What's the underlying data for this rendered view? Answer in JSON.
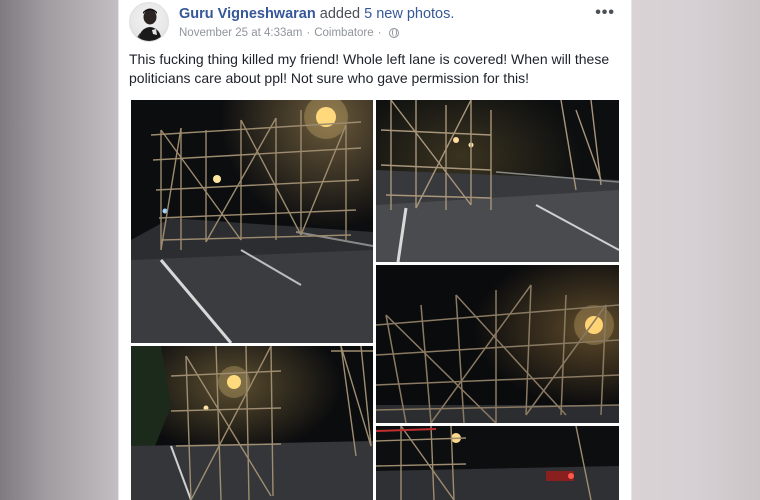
{
  "post": {
    "author": "Guru Vigneshwaran",
    "action": "added",
    "photo_count_text": "5 new photos.",
    "timestamp": "November 25 at 4:33am",
    "location": "Coimbatore",
    "separator": "·",
    "privacy_icon": "globe-icon",
    "more_icon": "•••",
    "text": "This fucking thing killed my friend! Whole left lane is covered! When will these politicians care about ppl! Not sure who gave permission for this!"
  },
  "colors": {
    "link": "#365899",
    "text": "#1d2129",
    "meta": "#90949c"
  }
}
